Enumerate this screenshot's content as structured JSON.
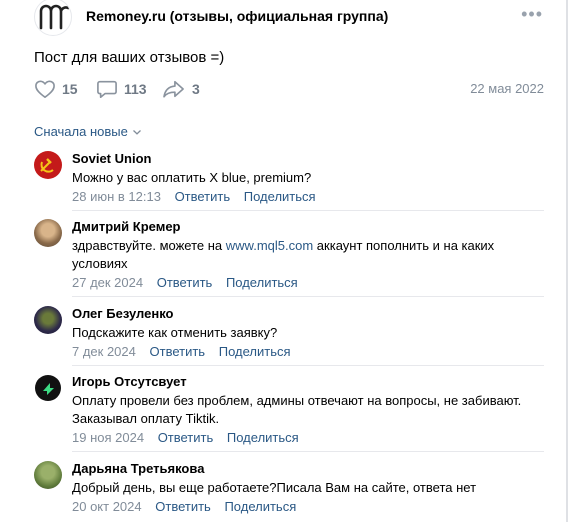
{
  "post": {
    "group_name": "Remoney.ru (отзывы, официальная группа)",
    "text": "Пост для ваших отзывов =)",
    "likes": "15",
    "comments": "113",
    "shares": "3",
    "date": "22 мая 2022"
  },
  "sort_label": "Сначала новые",
  "comments": [
    {
      "author": "Soviet Union",
      "text": "Можно у вас оплатить X blue, premium?",
      "date": "28 июн в 12:13",
      "reply": "Ответить",
      "share": "Поделиться"
    },
    {
      "author": "Дмитрий Кремер",
      "text_before": "здравствуйте. можете на ",
      "link": "www.mql5.com",
      "text_after": " аккаунт пополнить и на каких условиях",
      "date": "27 дек 2024",
      "reply": "Ответить",
      "share": "Поделиться"
    },
    {
      "author": "Олег Безуленко",
      "text": "Подскажите как отменить заявку?",
      "date": "7 дек 2024",
      "reply": "Ответить",
      "share": "Поделиться"
    },
    {
      "author": "Игорь Отсутсвует",
      "text": "Оплату провели без проблем, админы отвечают на вопросы, не забивают. Заказывал оплату Tiktik.",
      "date": "19 ноя 2024",
      "reply": "Ответить",
      "share": "Поделиться"
    },
    {
      "author": "Дарьяна Третьякова",
      "text": "Добрый день, вы еще работаете?Писала Вам на сайте, ответа нет",
      "date": "20 окт 2024",
      "reply": "Ответить",
      "share": "Поделиться"
    }
  ],
  "icons": {
    "like": "heart-icon",
    "comment": "comment-bubble-icon",
    "share": "share-arrow-icon",
    "more": "more-dots-icon",
    "sort": "chevron-down-icon"
  },
  "colors": {
    "link": "#2a5885",
    "muted": "#818c99",
    "icon": "#99a2ad"
  }
}
